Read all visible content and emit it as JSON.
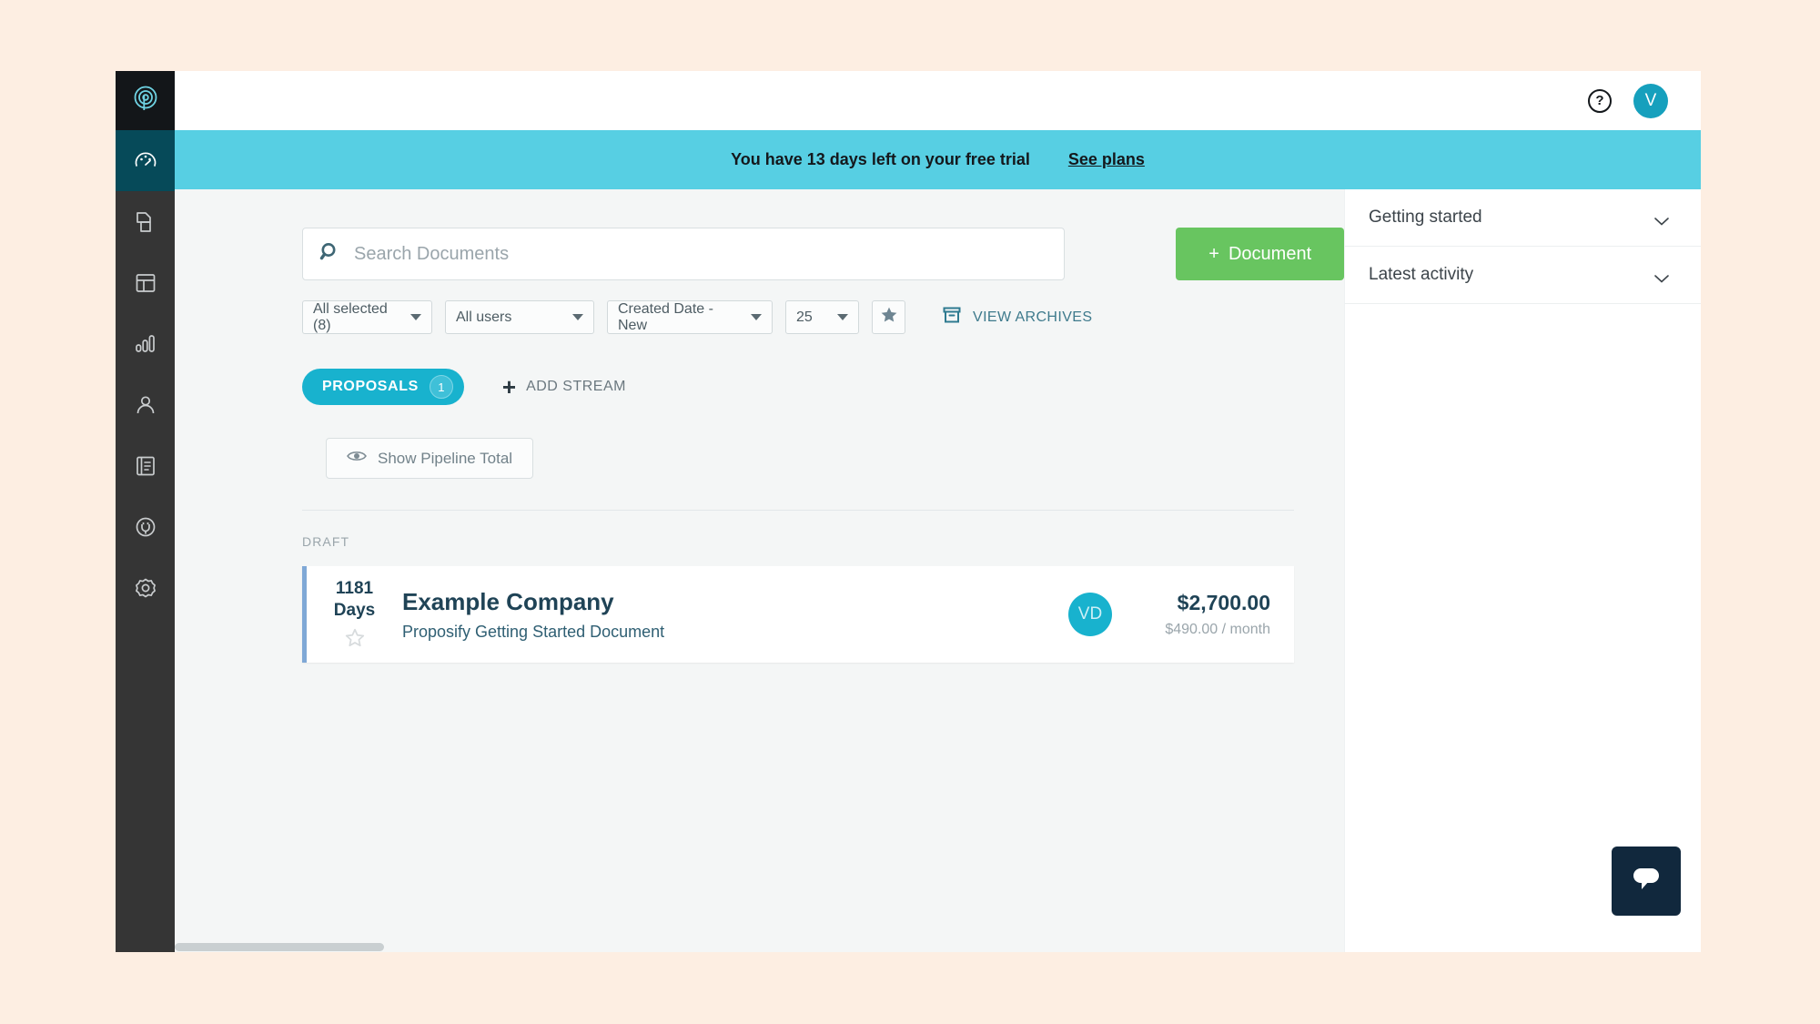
{
  "topbar": {
    "help_icon": "question-mark-circle-icon",
    "help_label": "?",
    "avatar_initial": "V"
  },
  "trial_banner": {
    "message": "You have 13 days left on your free trial",
    "link_label": "See plans",
    "background_color": "#57CFE3"
  },
  "sidebar": {
    "logo_icon": "proposify-logo-icon",
    "items": [
      {
        "icon": "dashboard-gauge-icon",
        "active": true
      },
      {
        "icon": "documents-icon",
        "active": false
      },
      {
        "icon": "templates-table-icon",
        "active": false
      },
      {
        "icon": "analytics-bar-chart-icon",
        "active": false
      },
      {
        "icon": "contacts-person-icon",
        "active": false
      },
      {
        "icon": "content-library-book-icon",
        "active": false
      },
      {
        "icon": "integrations-plug-icon",
        "active": false
      },
      {
        "icon": "settings-gear-icon",
        "active": false
      }
    ]
  },
  "search": {
    "icon": "search-icon",
    "placeholder": "Search Documents",
    "value": ""
  },
  "new_document_button": {
    "label": "Document",
    "plus": "+",
    "color": "#68C560"
  },
  "filters": [
    {
      "name": "status-filter",
      "label": "All selected (8)"
    },
    {
      "name": "users-filter",
      "label": "All users"
    },
    {
      "name": "sort-filter",
      "label": "Created Date - New"
    },
    {
      "name": "page-size-filter",
      "label": "25"
    }
  ],
  "star_filter_icon": "star-filled-icon",
  "view_archives": {
    "icon": "archive-box-icon",
    "label": "VIEW ARCHIVES",
    "color": "#3E7A8C"
  },
  "streams": {
    "active_tab": {
      "label": "PROPOSALS",
      "count": "1"
    },
    "add_stream": {
      "plus": "+",
      "label": "ADD STREAM"
    }
  },
  "pipeline_button": {
    "icon": "eye-icon",
    "label": "Show Pipeline Total"
  },
  "sections": [
    {
      "heading": "DRAFT",
      "documents": [
        {
          "days_number": "1181",
          "days_unit": "Days",
          "star_icon": "star-outline-icon",
          "title": "Example Company",
          "subtitle": "Proposify Getting Started Document",
          "owner_initials": "VD",
          "total": "$2,700.00",
          "recurring": "$490.00 / month"
        }
      ]
    }
  ],
  "right_panel": {
    "accordions": [
      {
        "label": "Getting started",
        "icon": "chevron-down-icon"
      },
      {
        "label": "Latest activity",
        "icon": "chevron-down-icon"
      }
    ]
  },
  "chat_widget": {
    "icon": "chat-bubble-icon",
    "color": "#11283D"
  }
}
